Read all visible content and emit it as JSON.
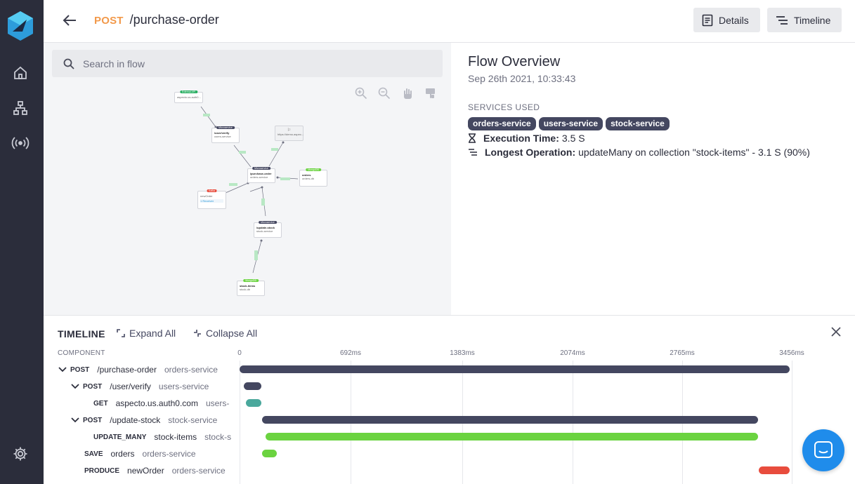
{
  "header": {
    "method": "POST",
    "route": "/purchase-order",
    "details_label": "Details",
    "timeline_label": "Timeline"
  },
  "search": {
    "placeholder": "Search in flow"
  },
  "graph": {
    "nodes": [
      {
        "chip": "External API",
        "title": "aspecto.us.auth0...",
        "chip_color": "#27ae60"
      },
      {
        "chip": "Microservice",
        "title": "/user/verify",
        "sub": "users-service"
      },
      {
        "title": "https://demo.aspec..."
      },
      {
        "chip": "Microservice",
        "title": "/purchase-order",
        "sub": "orders-service"
      },
      {
        "chip": "MongoDB",
        "title": "orders",
        "sub": "orders-db"
      },
      {
        "chip": "Kafka",
        "title": "newOrder",
        "sub": "1 Receiver"
      },
      {
        "chip": "Microservice",
        "title": "/update-stock",
        "sub": "stock-service"
      },
      {
        "chip": "MongoDB",
        "title": "stock-items",
        "sub": "stock-db"
      }
    ]
  },
  "overview": {
    "title": "Flow Overview",
    "date": "Sep 26th 2021, 10:33:43",
    "services_label": "SERVICES USED",
    "services": [
      "orders-service",
      "users-service",
      "stock-service"
    ],
    "exec_label": "Execution Time:",
    "exec_value": "3.5 S",
    "longest_label": "Longest Operation:",
    "longest_value": "updateMany on collection \"stock-items\" - 3.1 S  (90%)"
  },
  "timeline": {
    "title": "TIMELINE",
    "expand_label": "Expand All",
    "collapse_label": "Collapse All",
    "component_header": "COMPONENT",
    "scale": [
      "0",
      "692ms",
      "1383ms",
      "2074ms",
      "2765ms",
      "3456ms"
    ],
    "rows": [
      {
        "method": "POST",
        "route": "/purchase-order",
        "service": "orders-service"
      },
      {
        "method": "POST",
        "route": "/user/verify",
        "service": "users-service"
      },
      {
        "method": "GET",
        "route": "aspecto.us.auth0.com",
        "service": "users-"
      },
      {
        "method": "POST",
        "route": "/update-stock",
        "service": "stock-service"
      },
      {
        "method": "UPDATE_MANY",
        "route": "stock-items",
        "service": "stock-s"
      },
      {
        "method": "SAVE",
        "route": "orders",
        "service": "orders-service"
      },
      {
        "method": "PRODUCE",
        "route": "newOrder",
        "service": "orders-service"
      }
    ]
  },
  "colors": {
    "sidebar": "#2b2d3b",
    "method": "#f2994a",
    "bar_service": "#444760",
    "bar_http": "#4aa89c",
    "bar_db": "#6bd340",
    "bar_kafka": "#e84c3d",
    "chat": "#1f8ceb"
  }
}
